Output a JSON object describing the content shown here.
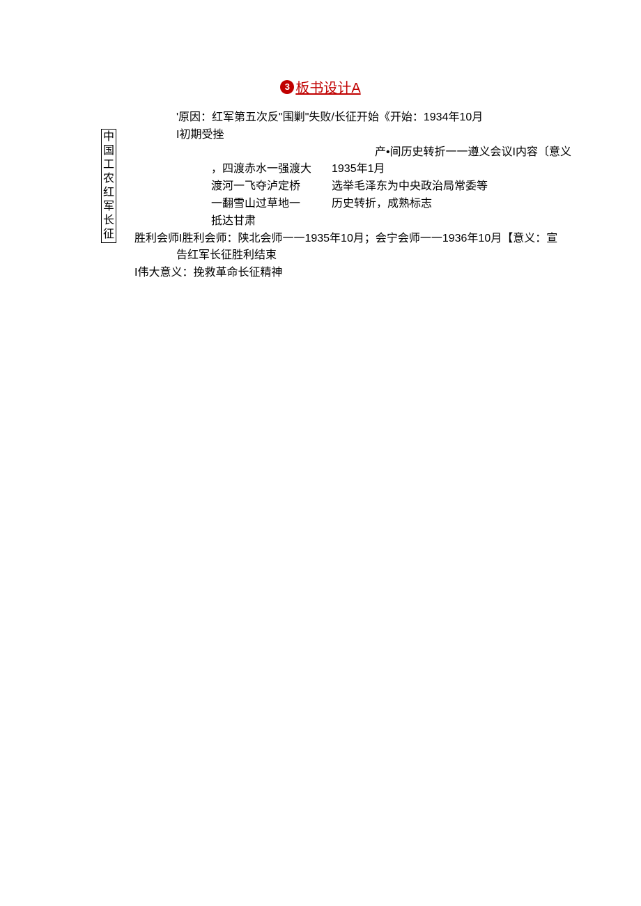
{
  "title": {
    "num": "3",
    "text": "板书设计A"
  },
  "vlabel": [
    "中",
    "国",
    "工",
    "农",
    "红",
    "军",
    "长",
    "征"
  ],
  "lines": {
    "l1": "'原因：红军第五次反\"围剿\"失败/长征开始《开始：1934年10月",
    "l2": "I初期受挫",
    "l3": "产•间历史转折一一遵义会议I内容〔意义",
    "col": {
      "left1": "，四渡赤水一强渡大",
      "right1": "1935年1月",
      "left2": "渡河一飞夺泸定桥",
      "right2": "选举毛泽东为中央政治局常委等",
      "left3": "一翻雪山过草地一",
      "right3": "历史转折，成熟标志",
      "left4": "抵达甘肃",
      "right4": ""
    },
    "l4a": "胜利会师I胜利会师：陕北会师一一1935年10月；会宁会师一一1936年10月【意义：宣",
    "l4b": "告红军长征胜利结束",
    "l5": "I伟大意义：挽救革命长征精神"
  }
}
